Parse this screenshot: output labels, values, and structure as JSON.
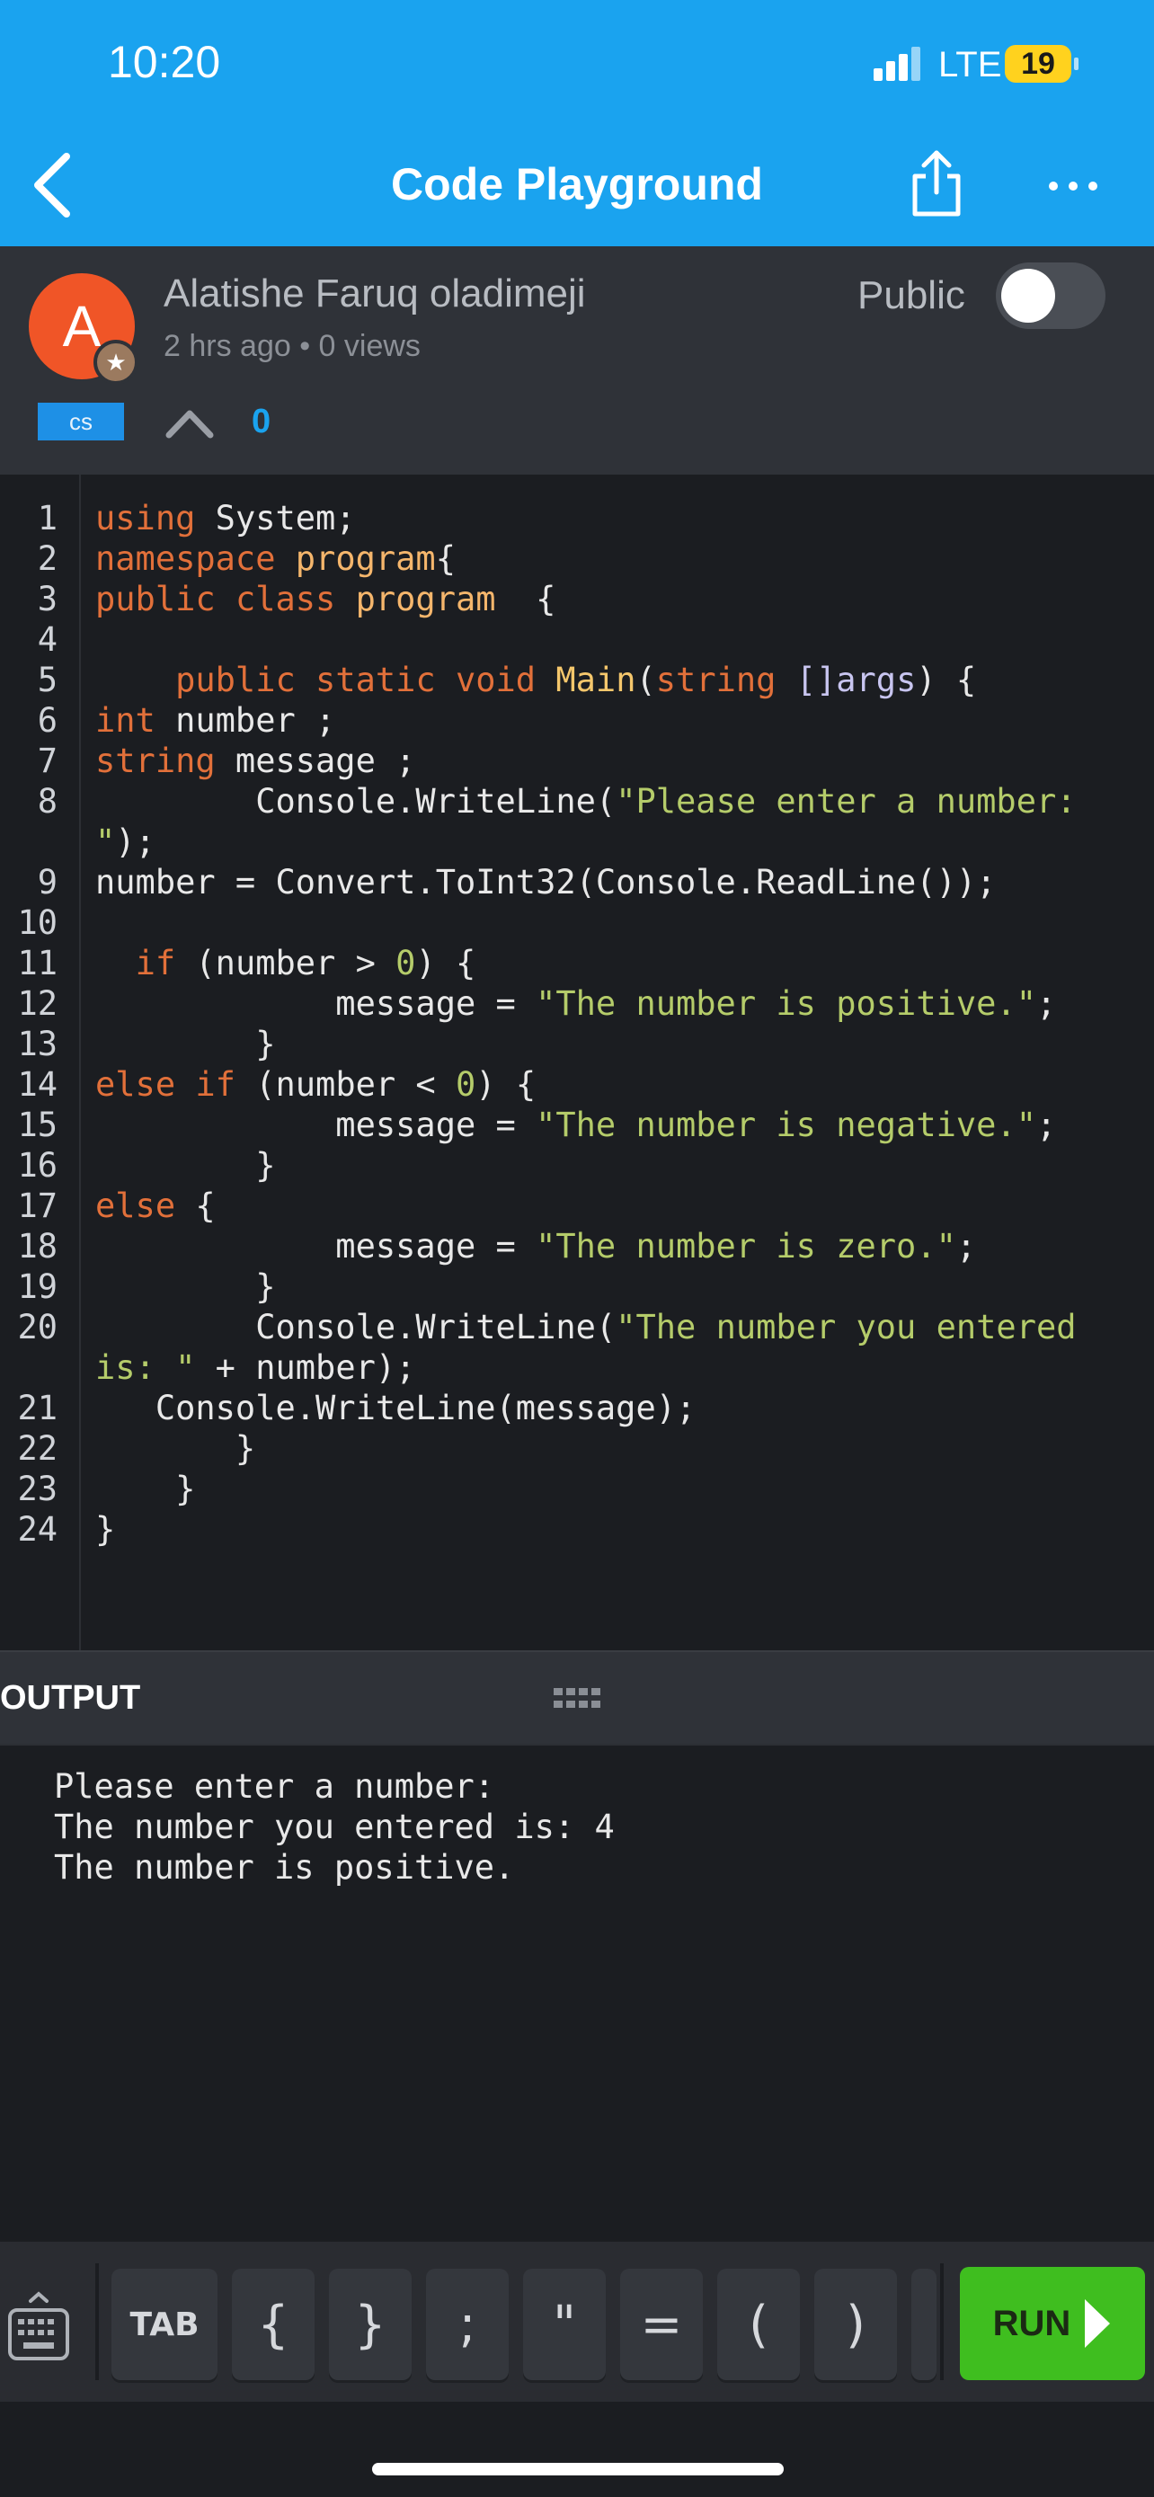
{
  "status": {
    "time": "10:20",
    "network": "LTE",
    "battery": "19"
  },
  "nav": {
    "title": "Code Playground"
  },
  "author": {
    "avatar_letter": "A",
    "name": "Alatishe Faruq oladimeji",
    "meta": "2 hrs ago • 0 views",
    "public_label": "Public",
    "language_tag": "cs",
    "votes": "0"
  },
  "code": {
    "line_numbers": [
      "1",
      "2",
      "3",
      "4",
      "5",
      "6",
      "7",
      "8",
      "9",
      "10",
      "11",
      "12",
      "13",
      "14",
      "15",
      "16",
      "17",
      "18",
      "19",
      "20",
      "21",
      "22",
      "23",
      "24"
    ]
  },
  "output": {
    "label": "OUTPUT",
    "lines": [
      "Please enter a number:",
      "The number you entered is: 4",
      "The number is positive."
    ]
  },
  "accessory": {
    "keys": [
      "TAB",
      "{",
      "}",
      ";",
      "\"",
      "=",
      "(",
      ")"
    ],
    "run_label": "RUN"
  },
  "icons": {
    "back": "chevron-left-icon",
    "share": "share-icon",
    "more": "more-dots-icon",
    "upvote": "chevron-up-icon",
    "keyboard": "keyboard-icon",
    "run": "play-triangle-icon"
  },
  "colors": {
    "accent": "#1aa3ef",
    "run": "#3fbe1f",
    "keyword": "#e2703a",
    "string": "#b5cc6a"
  }
}
